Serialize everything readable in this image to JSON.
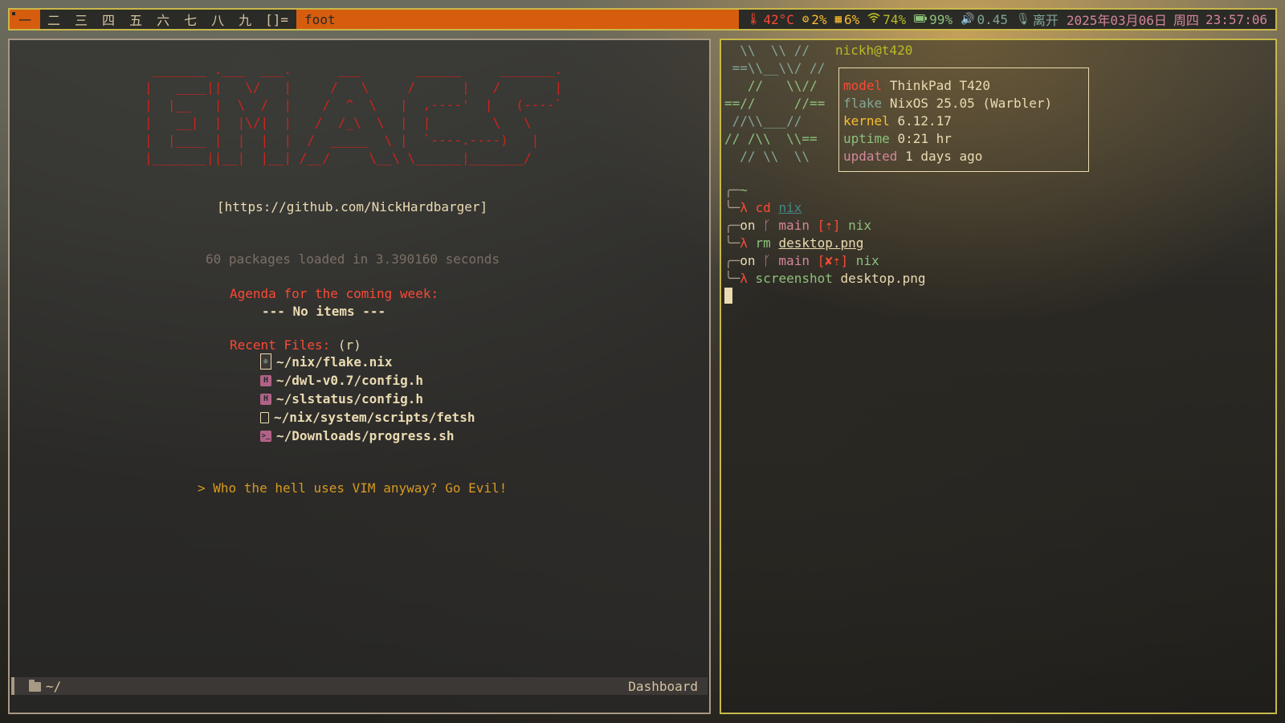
{
  "bar": {
    "tags": [
      "一",
      "二",
      "三",
      "四",
      "五",
      "六",
      "七",
      "八",
      "九"
    ],
    "active_tag": 0,
    "layout": "[]=",
    "title": "foot",
    "status": {
      "temp": "42°C",
      "cpu": "2%",
      "mem": "6%",
      "wifi": "74%",
      "battery": "99%",
      "volume": "0.45",
      "mic": "离开",
      "date": "2025年03月06日",
      "weekday": "周四",
      "time": "23:57:06"
    },
    "icons": {
      "temp": "thermometer-icon",
      "cpu": "cpu-icon",
      "mem": "memory-icon",
      "wifi": "wifi-icon",
      "battery": "battery-icon",
      "volume": "speaker-icon",
      "mic": "microphone-icon"
    }
  },
  "emacs": {
    "banner_lines": [
      " _______ .___  ___.      ___       ______     _______.",
      "|   ____||   \\/   |     /   \\     /      |   /       |",
      "|  |__   |  \\  /  |    /  ^  \\   |  ,----'  |   (----`",
      "|   __|  |  |\\/|  |   /  /_\\  \\  |  |        \\   \\",
      "|  |____ |  |  |  |  /  _____  \\ |  `----.----)   |",
      "|_______||__|  |__| /__/     \\__\\ \\______|_______/"
    ],
    "github": "[https://github.com/NickHardbarger]",
    "packages": "60 packages loaded in 3.390160 seconds",
    "agenda_title": "Agenda for the coming week:",
    "agenda_empty": "--- No items ---",
    "recent_title": "Recent Files:",
    "recent_key": "(r)",
    "recent_files": [
      "~/nix/flake.nix",
      "~/dwl-v0.7/config.h",
      "~/slstatus/config.h",
      "~/nix/system/scripts/fetsh",
      "~/Downloads/progress.sh"
    ],
    "quote": "> Who the hell uses VIM anyway? Go Evil!",
    "modeline_path": "~/",
    "modeline_mode": "Dashboard"
  },
  "terminal": {
    "logo_lines": [
      "  \\\\  \\\\ //",
      " ==\\\\__\\\\/ //",
      "   //   \\\\//",
      "==//     //==",
      " //\\\\___//",
      "// /\\\\  \\\\==",
      "  // \\\\  \\\\"
    ],
    "userhost": "nickh@t420",
    "info": [
      {
        "key": "model",
        "value": "ThinkPad T420"
      },
      {
        "key": "flake",
        "value": "NixOS 25.05 (Warbler)"
      },
      {
        "key": "kernel",
        "value": "6.12.17"
      },
      {
        "key": "uptime",
        "value": "0:21 hr"
      },
      {
        "key": "updated",
        "value": "1 days ago"
      }
    ],
    "prompt_home": "~",
    "lambda": "λ",
    "cmd1": "cd",
    "arg1": "nix",
    "on": "on",
    "branch_icon": "",
    "branch": "main",
    "status1": "[⇡]",
    "dir": "nix",
    "cmd2": "rm",
    "arg2": "desktop.png",
    "status2": "[✘⇡]",
    "cmd3": "screenshot",
    "arg3": "desktop.png"
  }
}
